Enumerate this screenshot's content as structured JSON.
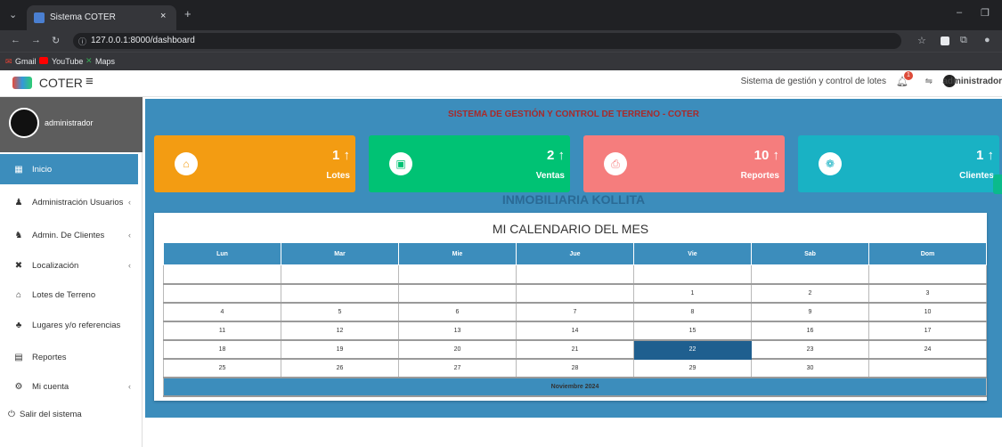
{
  "browser": {
    "tab_title": "Sistema COTER",
    "url": "127.0.0.1:8000/dashboard",
    "bookmarks": [
      "Gmail",
      "YouTube",
      "Maps"
    ]
  },
  "header": {
    "brand": "COTER",
    "system_label": "Sistema de gestión y control de lotes",
    "notification_count": "1",
    "user": "administrador"
  },
  "sidebar": {
    "username": "administrador",
    "items": [
      {
        "label": "Inicio",
        "icon": "dashboard-icon"
      },
      {
        "label": "Administración Usuarios",
        "icon": "user-icon"
      },
      {
        "label": "Admin. De Clientes",
        "icon": "users-icon"
      },
      {
        "label": "Localización",
        "icon": "map-icon"
      },
      {
        "label": "Lotes de Terreno",
        "icon": "home-icon"
      },
      {
        "label": "Lugares y/o referencias",
        "icon": "tree-icon"
      },
      {
        "label": "Reportes",
        "icon": "file-icon"
      },
      {
        "label": "Mi cuenta",
        "icon": "cogs-icon"
      },
      {
        "label": "Salir del sistema",
        "icon": "power-icon"
      }
    ]
  },
  "main": {
    "title": "SISTEMA DE GESTIÓN Y CONTROL DE TERRENO - COTER",
    "boxes": [
      {
        "value": "1",
        "label": "Lotes",
        "color": "#f39c12"
      },
      {
        "value": "2",
        "label": "Ventas",
        "color": "#00c274"
      },
      {
        "value": "10",
        "label": "Reportes",
        "color": "#f57d7d"
      },
      {
        "value": "1",
        "label": "Clientes",
        "color": "#19b2c4"
      }
    ],
    "company": "INMOBILIARIA KOLLITA",
    "calendar": {
      "title": "MI CALENDARIO DEL MES",
      "days": [
        "Lun",
        "Mar",
        "Mie",
        "Jue",
        "Vie",
        "Sab",
        "Dom"
      ],
      "weeks": [
        [
          "",
          "",
          "",
          "",
          "",
          "",
          ""
        ],
        [
          "",
          "",
          "",
          "",
          "1",
          "2",
          "3"
        ],
        [
          "4",
          "5",
          "6",
          "7",
          "8",
          "9",
          "10"
        ],
        [
          "11",
          "12",
          "13",
          "14",
          "15",
          "16",
          "17"
        ],
        [
          "18",
          "19",
          "20",
          "21",
          "22",
          "23",
          "24"
        ],
        [
          "25",
          "26",
          "27",
          "28",
          "29",
          "30",
          ""
        ]
      ],
      "today": "22",
      "month": "Noviembre 2024"
    }
  }
}
